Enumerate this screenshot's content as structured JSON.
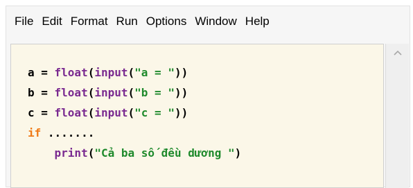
{
  "menu": {
    "items": [
      "File",
      "Edit",
      "Format",
      "Run",
      "Options",
      "Window",
      "Help"
    ]
  },
  "editor": {
    "lines": [
      [
        {
          "t": "a = ",
          "c": "plain"
        },
        {
          "t": "float",
          "c": "builtin"
        },
        {
          "t": "(",
          "c": "plain"
        },
        {
          "t": "input",
          "c": "builtin"
        },
        {
          "t": "(",
          "c": "plain"
        },
        {
          "t": "\"a = \"",
          "c": "string"
        },
        {
          "t": "))",
          "c": "plain"
        }
      ],
      [
        {
          "t": "b = ",
          "c": "plain"
        },
        {
          "t": "float",
          "c": "builtin"
        },
        {
          "t": "(",
          "c": "plain"
        },
        {
          "t": "input",
          "c": "builtin"
        },
        {
          "t": "(",
          "c": "plain"
        },
        {
          "t": "\"b = \"",
          "c": "string"
        },
        {
          "t": "))",
          "c": "plain"
        }
      ],
      [
        {
          "t": "c = ",
          "c": "plain"
        },
        {
          "t": "float",
          "c": "builtin"
        },
        {
          "t": "(",
          "c": "plain"
        },
        {
          "t": "input",
          "c": "builtin"
        },
        {
          "t": "(",
          "c": "plain"
        },
        {
          "t": "\"c = \"",
          "c": "string"
        },
        {
          "t": "))",
          "c": "plain"
        }
      ],
      [
        {
          "t": "if",
          "c": "keyword"
        },
        {
          "t": " .......",
          "c": "plain"
        }
      ],
      [
        {
          "t": "    ",
          "c": "plain"
        },
        {
          "t": "print",
          "c": "builtin"
        },
        {
          "t": "(",
          "c": "plain"
        },
        {
          "t": "\"Cả ba số đều dương \"",
          "c": "string"
        },
        {
          "t": ")",
          "c": "plain"
        }
      ]
    ]
  },
  "colors": {
    "builtin": "#7a2a90",
    "string": "#1f8a2c",
    "keyword": "#ef7a17",
    "plain": "#000000",
    "editor_bg": "#fbf7e8"
  },
  "scrollbar": {
    "up_icon": "chevron-up-icon"
  }
}
